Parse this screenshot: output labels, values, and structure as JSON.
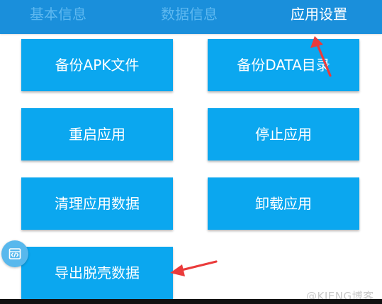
{
  "tabs": {
    "basic_info": "基本信息",
    "data_info": "数据信息",
    "app_settings": "应用设置"
  },
  "actions": {
    "backup_apk": "备份APK文件",
    "backup_data": "备份DATA目录",
    "restart_app": "重启应用",
    "stop_app": "停止应用",
    "clear_app_data": "清理应用数据",
    "uninstall_app": "卸载应用",
    "export_unpacked_data": "导出脱壳数据"
  },
  "watermark": "@KIENG博客",
  "colors": {
    "tabbar": "#1a8fdb",
    "button": "#0ba7ef",
    "active_tab_text": "#ffffff",
    "inactive_tab_text": "#5db8f0",
    "annotation_arrow": "#ea3b3b"
  },
  "icons": {
    "floating_button": "code-window-icon",
    "annotations": "arrow-pointer-icon"
  }
}
